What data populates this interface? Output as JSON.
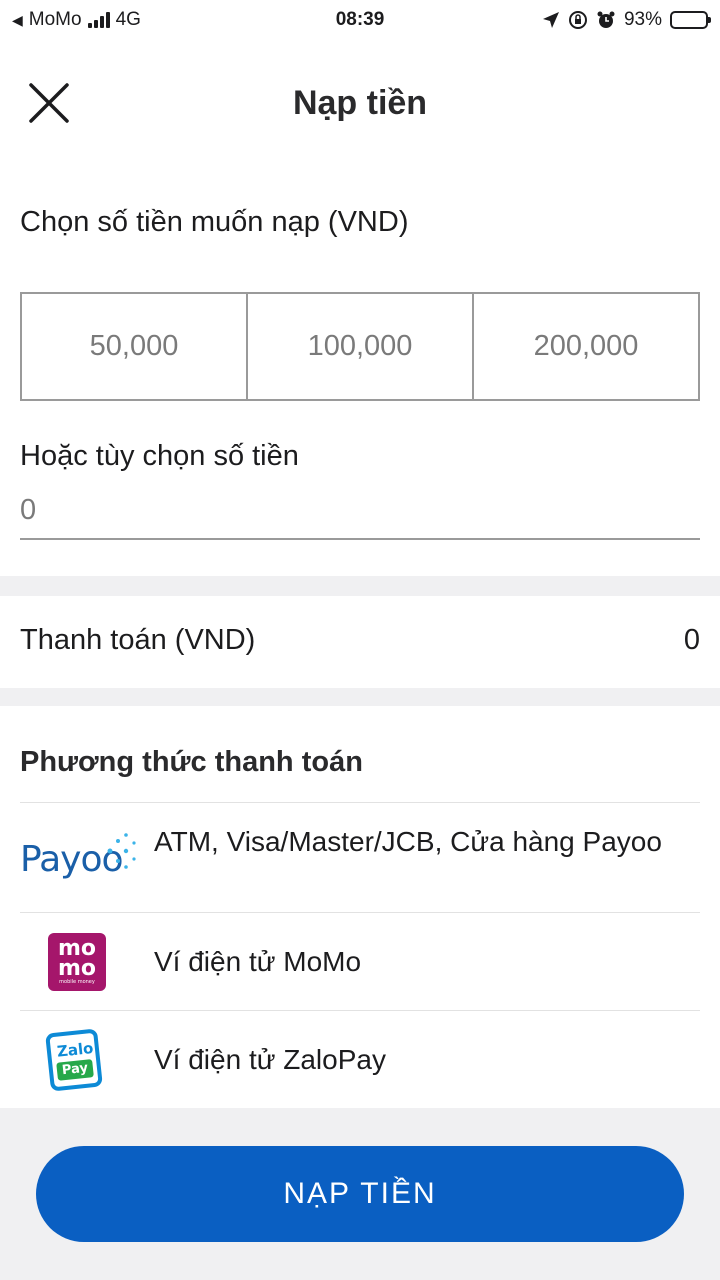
{
  "status_bar": {
    "back_app": "MoMo",
    "network": "4G",
    "time": "08:39",
    "battery": "93%",
    "battery_level": 0.93
  },
  "header": {
    "title": "Nạp tiền"
  },
  "amount": {
    "label": "Chọn số tiền muốn nạp (VND)",
    "options": [
      "50,000",
      "100,000",
      "200,000"
    ]
  },
  "custom": {
    "label": "Hoặc tùy chọn số tiền",
    "placeholder": "0"
  },
  "payment": {
    "label": "Thanh toán (VND)",
    "value": "0"
  },
  "methods": {
    "title": "Phương thức thanh toán",
    "items": [
      {
        "label": "ATM, Visa/Master/JCB, Cửa hàng Payoo",
        "icon": "payoo-logo",
        "logo_text": "Payoo"
      },
      {
        "label": "Ví điện tử MoMo",
        "icon": "momo-logo",
        "logo_text": "mo mo",
        "logo_sub": "mobile money"
      },
      {
        "label": "Ví điện tử ZaloPay",
        "icon": "zalopay-logo",
        "logo_text": "Zalo",
        "logo_sub": "Pay"
      }
    ]
  },
  "submit": {
    "label": "NẠP TIỀN"
  },
  "colors": {
    "primary": "#0a5fc2",
    "momo": "#a5166b",
    "zalo_blue": "#0d8ad6",
    "zalo_green": "#26a84a",
    "payoo": "#1a5fa8"
  }
}
